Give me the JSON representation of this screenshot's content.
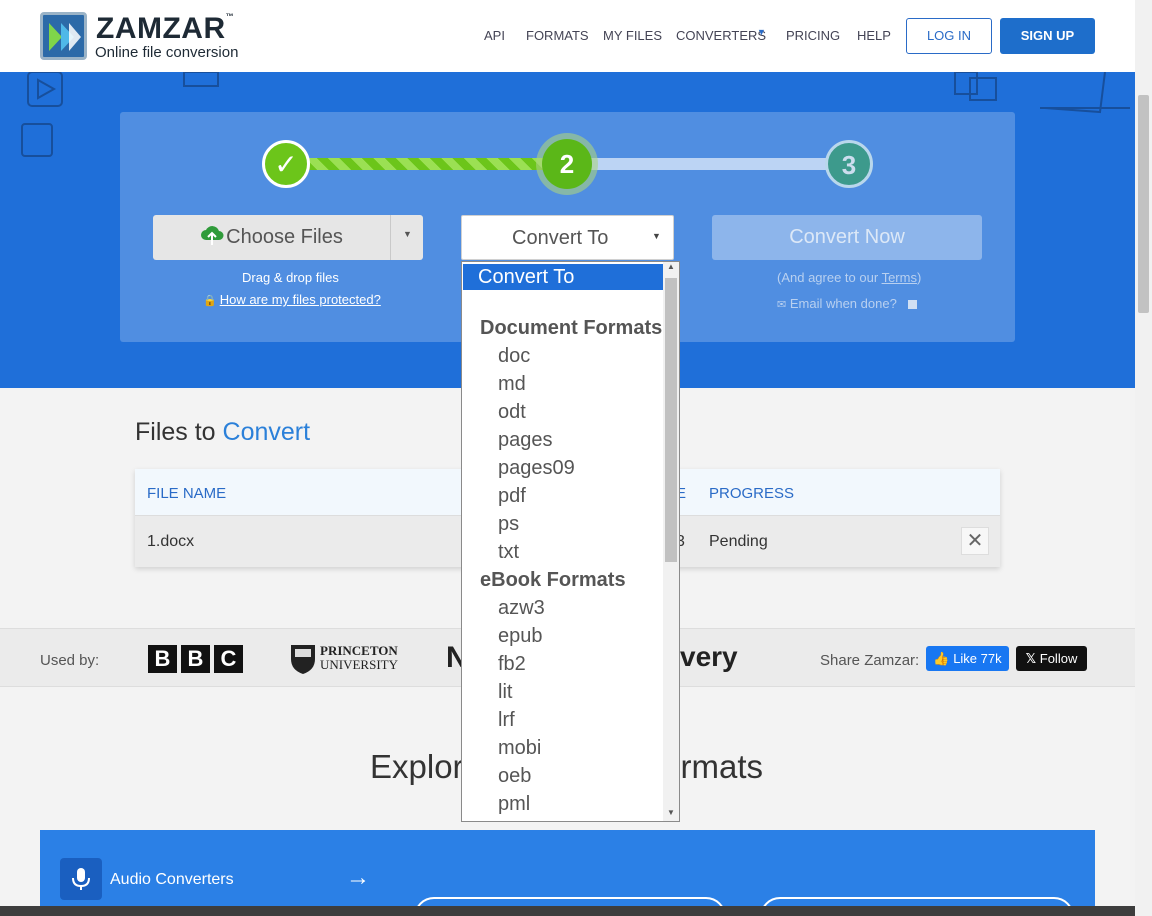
{
  "header": {
    "logo_title": "ZAMZAR",
    "logo_tm": "™",
    "logo_subtitle": "Online file conversion",
    "nav": [
      "API",
      "FORMATS",
      "MY FILES",
      "CONVERTERS",
      "PRICING",
      "HELP"
    ],
    "login_label": "LOG IN",
    "signup_label": "SIGN UP"
  },
  "steps": {
    "step1": "✓",
    "step2": "2",
    "step3": "3",
    "choose_files_label": "Choose Files",
    "convert_to_label": "Convert To",
    "convert_now_label": "Convert Now",
    "drag_drop_text": "Drag & drop files",
    "protected_link": "How are my files protected?",
    "agree_prefix": "(And agree to our ",
    "terms_link": "Terms",
    "agree_suffix": ")",
    "email_when_done": "Email when done?"
  },
  "files": {
    "heading_prefix": "Files to ",
    "heading_highlight": "Convert",
    "columns": [
      "FILE NAME",
      "E",
      "PROGRESS"
    ],
    "rows": [
      {
        "file_name": "1.docx",
        "size_fragment": "3",
        "progress": "Pending"
      }
    ]
  },
  "used_by": {
    "label": "Used by:",
    "bbc_letters": [
      "B",
      "B",
      "C"
    ],
    "princeton_line1": "PRINCETON",
    "princeton_line2": "UNIVERSITY",
    "partial_logo_1": "N",
    "partial_logo_2": "very",
    "share_label": "Share Zamzar:",
    "like_label": "Like 77k",
    "follow_label": "Follow"
  },
  "explore": {
    "heading_left": "Explor",
    "heading_right": "rmats",
    "audio_label": "Audio Converters",
    "arrow": "→"
  },
  "dropdown": {
    "selected": "Convert To",
    "groups": [
      {
        "label": "Document Formats",
        "items": [
          "doc",
          "md",
          "odt",
          "pages",
          "pages09",
          "pdf",
          "ps",
          "txt"
        ]
      },
      {
        "label": "eBook Formats",
        "items": [
          "azw3",
          "epub",
          "fb2",
          "lit",
          "lrf",
          "mobi",
          "oeb",
          "pml"
        ]
      }
    ]
  },
  "colors": {
    "brand_blue": "#1f6fd9",
    "accent_green": "#6cc51a",
    "link_blue": "#2b80d9"
  }
}
